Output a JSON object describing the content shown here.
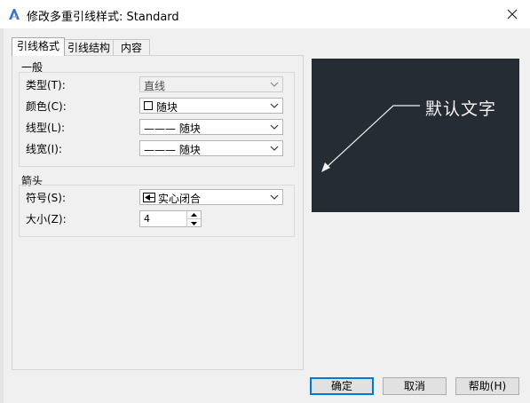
{
  "window": {
    "title": "修改多重引线样式: Standard"
  },
  "tabs": [
    {
      "label": "引线格式",
      "active": true
    },
    {
      "label": "引线结构",
      "active": false
    },
    {
      "label": "内容",
      "active": false
    }
  ],
  "general": {
    "title": "一般",
    "type_label": "类型(T):",
    "type_value": "直线",
    "color_label": "颜色(C):",
    "color_value": "随块",
    "linetype_label": "线型(L):",
    "linetype_value": "——— 随块",
    "lineweight_label": "线宽(I):",
    "lineweight_value": "——— 随块"
  },
  "arrow": {
    "title": "箭头",
    "symbol_label": "符号(S):",
    "symbol_value": "实心闭合",
    "size_label": "大小(Z):",
    "size_value": "4"
  },
  "preview": {
    "text": "默认文字"
  },
  "buttons": {
    "ok": "确定",
    "cancel": "取消",
    "help": "帮助(H)"
  },
  "colors": {
    "preview_bg": "#262c33",
    "default_button_border": "#0078d7"
  }
}
